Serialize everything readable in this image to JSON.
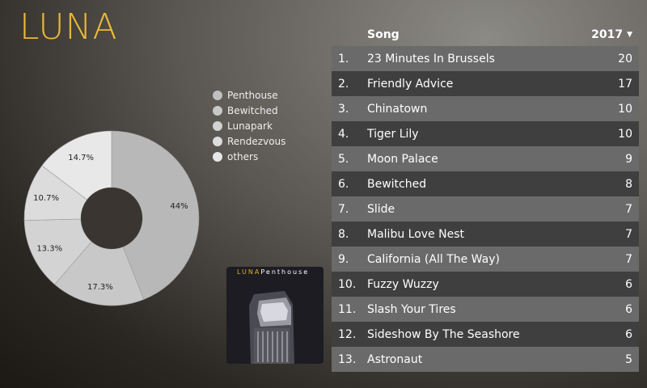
{
  "app": {
    "title": "LUNA"
  },
  "legend": [
    {
      "label": "Penthouse",
      "color": "#c0c0c0"
    },
    {
      "label": "Bewitched",
      "color": "#c8c8c8"
    },
    {
      "label": "Lunapark",
      "color": "#d2d2d2"
    },
    {
      "label": "Rendezvous",
      "color": "#dcdcdc"
    },
    {
      "label": "others",
      "color": "#e6e6e6"
    }
  ],
  "chart_data": {
    "type": "pie",
    "series": [
      {
        "name": "Penthouse",
        "value": 44,
        "label": "44%",
        "color": "#b8b8b8"
      },
      {
        "name": "Bewitched",
        "value": 17.3,
        "label": "17.3%",
        "color": "#c8c8c8"
      },
      {
        "name": "Lunapark",
        "value": 13.3,
        "label": "13.3%",
        "color": "#d3d3d3"
      },
      {
        "name": "Rendezvous",
        "value": 10.7,
        "label": "10.7%",
        "color": "#dcdcdc"
      },
      {
        "name": "others",
        "value": 14.7,
        "label": "14.7%",
        "color": "#e8e8e8"
      }
    ]
  },
  "album": {
    "brand": "LUNA",
    "title": "Penthouse"
  },
  "table": {
    "headers": {
      "song": "Song",
      "year": "2017"
    },
    "rows": [
      {
        "rank": "1.",
        "song": "23 Minutes In Brussels",
        "count": "20"
      },
      {
        "rank": "2.",
        "song": "Friendly Advice",
        "count": "17"
      },
      {
        "rank": "3.",
        "song": "Chinatown",
        "count": "10"
      },
      {
        "rank": "4.",
        "song": "Tiger Lily",
        "count": "10"
      },
      {
        "rank": "5.",
        "song": "Moon Palace",
        "count": "9"
      },
      {
        "rank": "6.",
        "song": "Bewitched",
        "count": "8"
      },
      {
        "rank": "7.",
        "song": "Slide",
        "count": "7"
      },
      {
        "rank": "8.",
        "song": "Malibu Love Nest",
        "count": "7"
      },
      {
        "rank": "9.",
        "song": "California (All The Way)",
        "count": "7"
      },
      {
        "rank": "10.",
        "song": "Fuzzy Wuzzy",
        "count": "6"
      },
      {
        "rank": "11.",
        "song": "Slash Your Tires",
        "count": "6"
      },
      {
        "rank": "12.",
        "song": "Sideshow By The Seashore",
        "count": "6"
      },
      {
        "rank": "13.",
        "song": "Astronaut",
        "count": "5"
      }
    ]
  }
}
